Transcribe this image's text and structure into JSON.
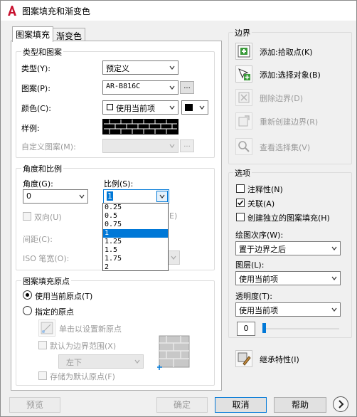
{
  "window": {
    "title": "图案填充和渐变色"
  },
  "tabs": [
    {
      "label": "图案填充",
      "active": true
    },
    {
      "label": "渐变色",
      "active": false
    }
  ],
  "type_pattern": {
    "title": "类型和图案",
    "type_label": "类型(Y):",
    "type_value": "预定义",
    "pattern_label": "图案(P):",
    "pattern_value": "AR-B816C",
    "color_label": "颜色(C):",
    "color_value": "使用当前项",
    "sample_label": "样例:",
    "custom_label": "自定义图案(M):",
    "ellipsis": "..."
  },
  "angle_scale": {
    "title": "角度和比例",
    "angle_label": "角度(G):",
    "angle_value": "0",
    "scale_label": "比例(S):",
    "scale_value": "1",
    "double_label": "双向(U)",
    "relative_label": "E)",
    "spacing_label": "间距(C):",
    "iso_label": "ISO 笔宽(O):",
    "scale_options": [
      "0.25",
      "0.5",
      "0.75",
      "1",
      "1.25",
      "1.5",
      "1.75",
      "2"
    ],
    "selected_index": 3
  },
  "origin": {
    "title": "图案填充原点",
    "use_current": "使用当前原点(T)",
    "specified": "指定的原点",
    "click_set": "单击以设置新原点",
    "default_boundary": "默认为边界范围(X)",
    "position_value": "左下",
    "store_default": "存储为默认原点(F)"
  },
  "boundaries": {
    "title": "边界",
    "add_pick": "添加:拾取点(K)",
    "add_select": "添加:选择对象(B)",
    "remove": "删除边界(D)",
    "recreate": "重新创建边界(R)",
    "view_set": "查看选择集(V)"
  },
  "options": {
    "title": "选项",
    "annotative": "注释性(N)",
    "associative": "关联(A)",
    "separate": "创建独立的图案填充(H)",
    "draw_order_label": "绘图次序(W):",
    "draw_order_value": "置于边界之后",
    "layer_label": "图层(L):",
    "layer_value": "使用当前项",
    "transparency_label": "透明度(T):",
    "transparency_value": "使用当前项",
    "transparency_number": "0",
    "inherit": "继承特性(I)"
  },
  "footer": {
    "preview": "预览",
    "ok": "确定",
    "cancel": "取消",
    "help": "帮助"
  },
  "colors": {
    "selection_blue": "#0078d7",
    "logo_red": "#c8102e"
  }
}
